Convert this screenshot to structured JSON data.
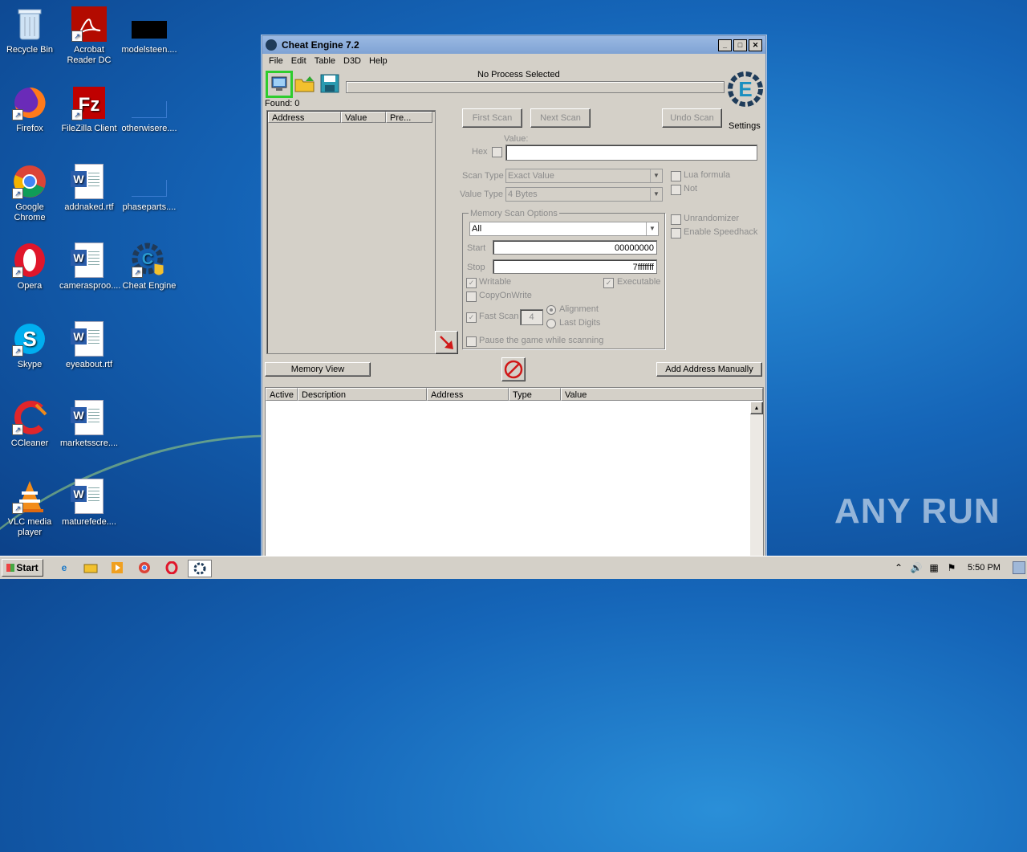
{
  "desktop": {
    "icons": [
      {
        "label": "Recycle Bin"
      },
      {
        "label": "Acrobat Reader DC"
      },
      {
        "label": "modelsteen...."
      },
      {
        "label": "Firefox"
      },
      {
        "label": "FileZilla Client"
      },
      {
        "label": "otherwisere...."
      },
      {
        "label": "Google Chrome"
      },
      {
        "label": "addnaked.rtf"
      },
      {
        "label": "phaseparts...."
      },
      {
        "label": "Opera"
      },
      {
        "label": "camerasproo...."
      },
      {
        "label": "Cheat Engine"
      },
      {
        "label": "Skype"
      },
      {
        "label": "eyeabout.rtf"
      },
      {
        "label": "CCleaner"
      },
      {
        "label": "marketsscre...."
      },
      {
        "label": "VLC media player"
      },
      {
        "label": "maturefede...."
      }
    ]
  },
  "window": {
    "title": "Cheat Engine 7.2",
    "menu": [
      "File",
      "Edit",
      "Table",
      "D3D",
      "Help"
    ],
    "process_label": "No Process Selected",
    "found": "Found: 0",
    "columns": [
      "Address",
      "Value",
      "Pre..."
    ],
    "first_scan": "First Scan",
    "next_scan": "Next Scan",
    "undo_scan": "Undo Scan",
    "settings": "Settings",
    "value_label": "Value:",
    "hex_label": "Hex",
    "scan_type_label": "Scan Type",
    "scan_type_value": "Exact Value",
    "value_type_label": "Value Type",
    "value_type_value": "4 Bytes",
    "memory_options_label": "Memory Scan Options",
    "memory_region": "All",
    "start_label": "Start",
    "start_value": "00000000",
    "stop_label": "Stop",
    "stop_value": "7fffffff",
    "writable": "Writable",
    "executable": "Executable",
    "copy_on_write": "CopyOnWrite",
    "fast_scan": "Fast Scan",
    "fast_scan_value": "4",
    "alignment": "Alignment",
    "last_digits": "Last Digits",
    "pause_game": "Pause the game while scanning",
    "lua_formula": "Lua formula",
    "not": "Not",
    "unrandomizer": "Unrandomizer",
    "enable_speedhack": "Enable Speedhack",
    "memory_view": "Memory View",
    "add_address": "Add Address Manually",
    "table_columns": [
      "Active",
      "Description",
      "Address",
      "Type",
      "Value"
    ]
  },
  "taskbar": {
    "start": "Start",
    "clock": "5:50 PM"
  },
  "watermark": "ANY RUN"
}
